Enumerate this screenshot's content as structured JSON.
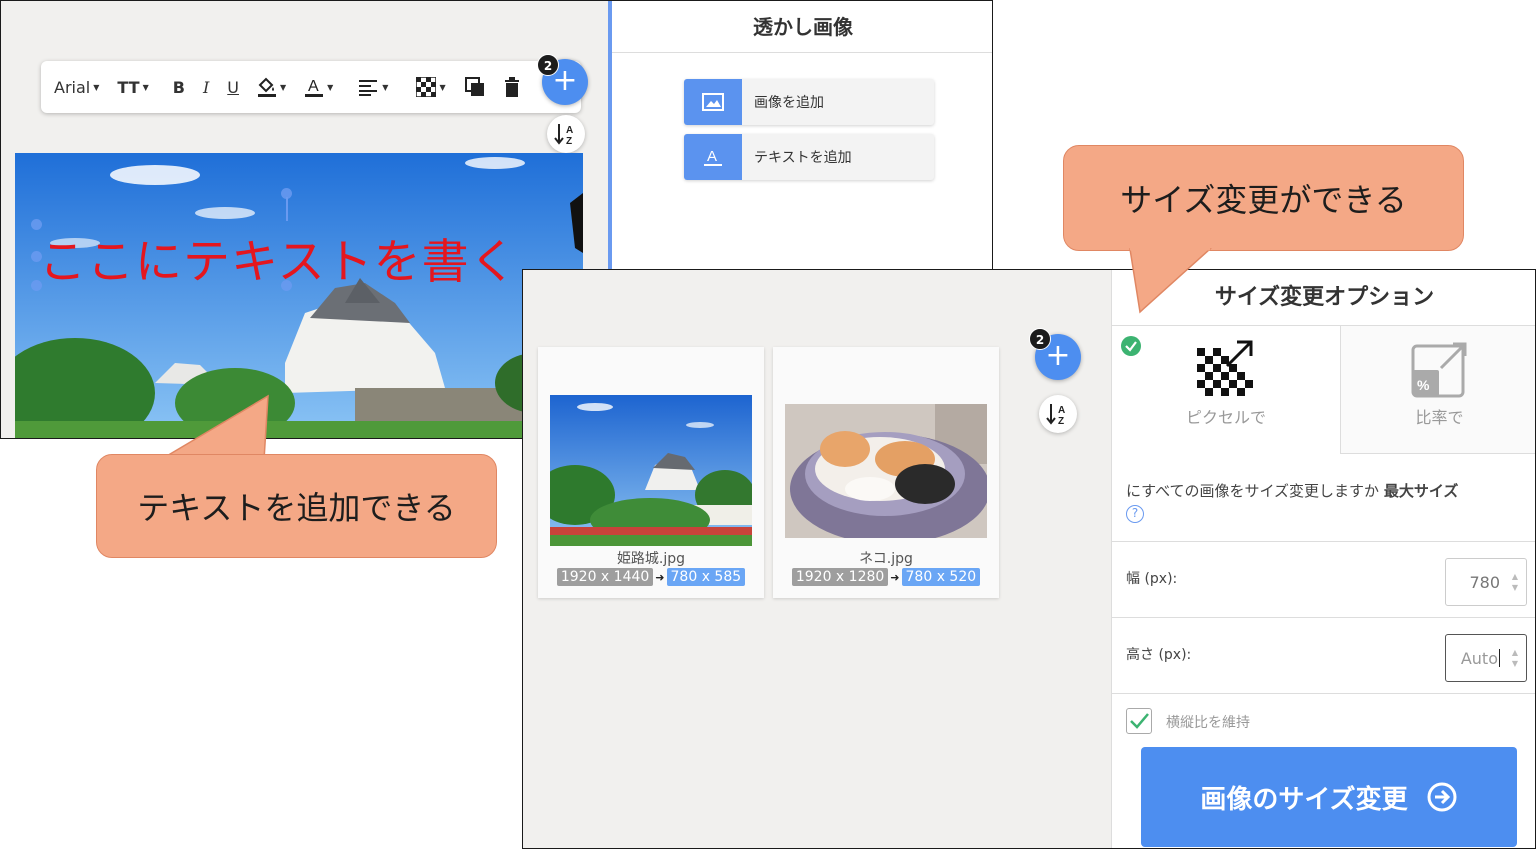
{
  "editor": {
    "panel_title": "透かし画像",
    "add_image_label": "画像を追加",
    "add_text_label": "テキストを追加",
    "toolbar": {
      "font_name": "Arial",
      "text_size_label": "TT",
      "bold_label": "B",
      "italic_label": "I",
      "underline_label": "U"
    },
    "badge_count": "2",
    "watermark_text": "ここにテキストを書く"
  },
  "resizer": {
    "badge_count": "2",
    "files": [
      {
        "name": "姫路城.jpg",
        "original": "1920 x 1440",
        "new": "780 x 585"
      },
      {
        "name": "ネコ.jpg",
        "original": "1920 x 1280",
        "new": "780 x 520"
      }
    ],
    "panel_title": "サイズ変更オプション",
    "options": {
      "by_pixels": "ピクセルで",
      "by_percent": "比率で"
    },
    "question": "にすべての画像をサイズ変更しますか",
    "max_size_label": "最大サイズ",
    "width_label": "幅 (px):",
    "width_value": "780",
    "height_label": "高さ (px):",
    "height_value": "Auto",
    "keep_ratio_label": "横縦比を維持",
    "keep_ratio_checked": true,
    "submit_label": "画像のサイズ変更"
  },
  "callouts": {
    "resize": "サイズ変更ができる",
    "add_text": "テキストを追加できる"
  },
  "colors": {
    "accent_blue": "#4d8ef0",
    "watermark_red": "#e4161e",
    "callout_fill": "#f4a886",
    "check_green": "#3cb371"
  }
}
